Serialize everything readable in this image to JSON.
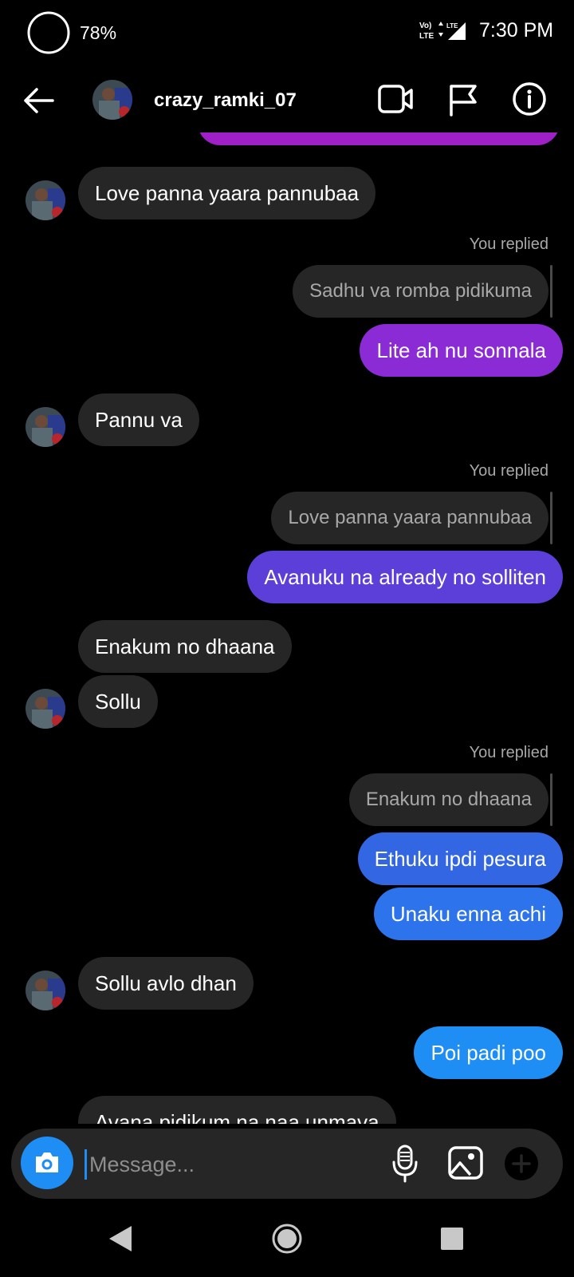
{
  "status_bar": {
    "battery": "78%",
    "network": "Vo) LTE",
    "time": "7:30 PM"
  },
  "header": {
    "contact_name": "crazy_ramki_07",
    "icons": [
      "back-arrow-icon",
      "video-call-icon",
      "flag-icon",
      "info-icon"
    ]
  },
  "messages": [
    {
      "side": "in",
      "text": "Love panna yaara pannubaa",
      "avatar": true
    },
    {
      "side": "out",
      "replied_label": "You replied",
      "quote": "Sadhu va romba pidikuma",
      "text": "Lite ah nu sonnala",
      "color": "#8a2bd6"
    },
    {
      "side": "in",
      "text": "Pannu va",
      "avatar": true
    },
    {
      "side": "out",
      "replied_label": "You replied",
      "quote": "Love panna yaara pannubaa",
      "text": "Avanuku na already no solliten",
      "color": "#5b3fd8"
    },
    {
      "side": "in",
      "text": "Enakum no dhaana",
      "avatar": false
    },
    {
      "side": "in",
      "text": "Sollu",
      "avatar": true
    },
    {
      "side": "out",
      "replied_label": "You replied",
      "quote": "Enakum no dhaana",
      "text": "Ethuku ipdi pesura",
      "color": "#3266e3"
    },
    {
      "side": "out",
      "text": "Unaku enna achi",
      "color": "#2d73ec"
    },
    {
      "side": "in",
      "text": "Sollu avlo dhan",
      "avatar": true
    },
    {
      "side": "out",
      "text": "Poi padi poo",
      "color": "#1e8ef5"
    },
    {
      "side": "in",
      "text": "Avana pidikum na naa unmava",
      "avatar": false
    }
  ],
  "composer": {
    "placeholder": "Message...",
    "icons": [
      "camera-icon",
      "microphone-icon",
      "gallery-icon",
      "plus-icon"
    ]
  },
  "colors": {
    "background": "#000000",
    "incoming_bubble": "#262626",
    "accent_blue": "#1e8ef5",
    "accent_purple": "#a020c8"
  }
}
